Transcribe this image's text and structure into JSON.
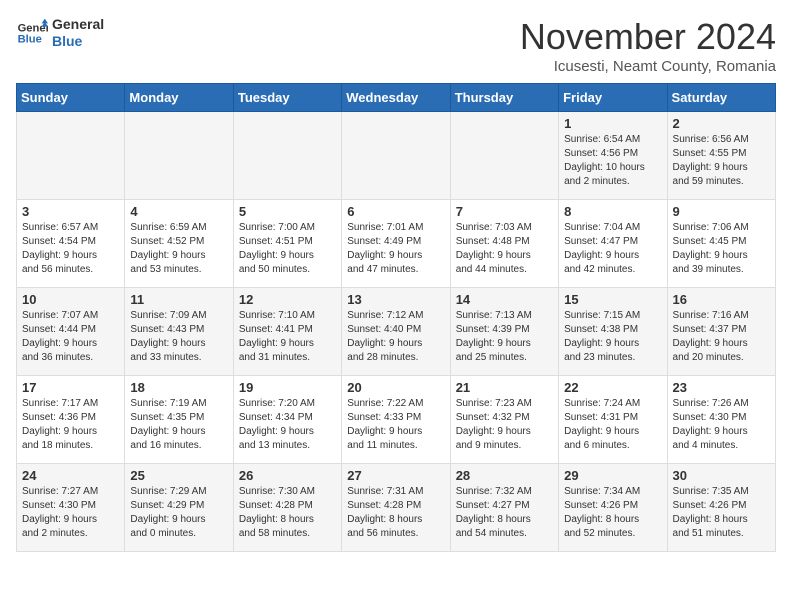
{
  "header": {
    "logo_line1": "General",
    "logo_line2": "Blue",
    "month_title": "November 2024",
    "subtitle": "Icusesti, Neamt County, Romania"
  },
  "weekdays": [
    "Sunday",
    "Monday",
    "Tuesday",
    "Wednesday",
    "Thursday",
    "Friday",
    "Saturday"
  ],
  "weeks": [
    [
      {
        "day": "",
        "info": ""
      },
      {
        "day": "",
        "info": ""
      },
      {
        "day": "",
        "info": ""
      },
      {
        "day": "",
        "info": ""
      },
      {
        "day": "",
        "info": ""
      },
      {
        "day": "1",
        "info": "Sunrise: 6:54 AM\nSunset: 4:56 PM\nDaylight: 10 hours\nand 2 minutes."
      },
      {
        "day": "2",
        "info": "Sunrise: 6:56 AM\nSunset: 4:55 PM\nDaylight: 9 hours\nand 59 minutes."
      }
    ],
    [
      {
        "day": "3",
        "info": "Sunrise: 6:57 AM\nSunset: 4:54 PM\nDaylight: 9 hours\nand 56 minutes."
      },
      {
        "day": "4",
        "info": "Sunrise: 6:59 AM\nSunset: 4:52 PM\nDaylight: 9 hours\nand 53 minutes."
      },
      {
        "day": "5",
        "info": "Sunrise: 7:00 AM\nSunset: 4:51 PM\nDaylight: 9 hours\nand 50 minutes."
      },
      {
        "day": "6",
        "info": "Sunrise: 7:01 AM\nSunset: 4:49 PM\nDaylight: 9 hours\nand 47 minutes."
      },
      {
        "day": "7",
        "info": "Sunrise: 7:03 AM\nSunset: 4:48 PM\nDaylight: 9 hours\nand 44 minutes."
      },
      {
        "day": "8",
        "info": "Sunrise: 7:04 AM\nSunset: 4:47 PM\nDaylight: 9 hours\nand 42 minutes."
      },
      {
        "day": "9",
        "info": "Sunrise: 7:06 AM\nSunset: 4:45 PM\nDaylight: 9 hours\nand 39 minutes."
      }
    ],
    [
      {
        "day": "10",
        "info": "Sunrise: 7:07 AM\nSunset: 4:44 PM\nDaylight: 9 hours\nand 36 minutes."
      },
      {
        "day": "11",
        "info": "Sunrise: 7:09 AM\nSunset: 4:43 PM\nDaylight: 9 hours\nand 33 minutes."
      },
      {
        "day": "12",
        "info": "Sunrise: 7:10 AM\nSunset: 4:41 PM\nDaylight: 9 hours\nand 31 minutes."
      },
      {
        "day": "13",
        "info": "Sunrise: 7:12 AM\nSunset: 4:40 PM\nDaylight: 9 hours\nand 28 minutes."
      },
      {
        "day": "14",
        "info": "Sunrise: 7:13 AM\nSunset: 4:39 PM\nDaylight: 9 hours\nand 25 minutes."
      },
      {
        "day": "15",
        "info": "Sunrise: 7:15 AM\nSunset: 4:38 PM\nDaylight: 9 hours\nand 23 minutes."
      },
      {
        "day": "16",
        "info": "Sunrise: 7:16 AM\nSunset: 4:37 PM\nDaylight: 9 hours\nand 20 minutes."
      }
    ],
    [
      {
        "day": "17",
        "info": "Sunrise: 7:17 AM\nSunset: 4:36 PM\nDaylight: 9 hours\nand 18 minutes."
      },
      {
        "day": "18",
        "info": "Sunrise: 7:19 AM\nSunset: 4:35 PM\nDaylight: 9 hours\nand 16 minutes."
      },
      {
        "day": "19",
        "info": "Sunrise: 7:20 AM\nSunset: 4:34 PM\nDaylight: 9 hours\nand 13 minutes."
      },
      {
        "day": "20",
        "info": "Sunrise: 7:22 AM\nSunset: 4:33 PM\nDaylight: 9 hours\nand 11 minutes."
      },
      {
        "day": "21",
        "info": "Sunrise: 7:23 AM\nSunset: 4:32 PM\nDaylight: 9 hours\nand 9 minutes."
      },
      {
        "day": "22",
        "info": "Sunrise: 7:24 AM\nSunset: 4:31 PM\nDaylight: 9 hours\nand 6 minutes."
      },
      {
        "day": "23",
        "info": "Sunrise: 7:26 AM\nSunset: 4:30 PM\nDaylight: 9 hours\nand 4 minutes."
      }
    ],
    [
      {
        "day": "24",
        "info": "Sunrise: 7:27 AM\nSunset: 4:30 PM\nDaylight: 9 hours\nand 2 minutes."
      },
      {
        "day": "25",
        "info": "Sunrise: 7:29 AM\nSunset: 4:29 PM\nDaylight: 9 hours\nand 0 minutes."
      },
      {
        "day": "26",
        "info": "Sunrise: 7:30 AM\nSunset: 4:28 PM\nDaylight: 8 hours\nand 58 minutes."
      },
      {
        "day": "27",
        "info": "Sunrise: 7:31 AM\nSunset: 4:28 PM\nDaylight: 8 hours\nand 56 minutes."
      },
      {
        "day": "28",
        "info": "Sunrise: 7:32 AM\nSunset: 4:27 PM\nDaylight: 8 hours\nand 54 minutes."
      },
      {
        "day": "29",
        "info": "Sunrise: 7:34 AM\nSunset: 4:26 PM\nDaylight: 8 hours\nand 52 minutes."
      },
      {
        "day": "30",
        "info": "Sunrise: 7:35 AM\nSunset: 4:26 PM\nDaylight: 8 hours\nand 51 minutes."
      }
    ]
  ]
}
